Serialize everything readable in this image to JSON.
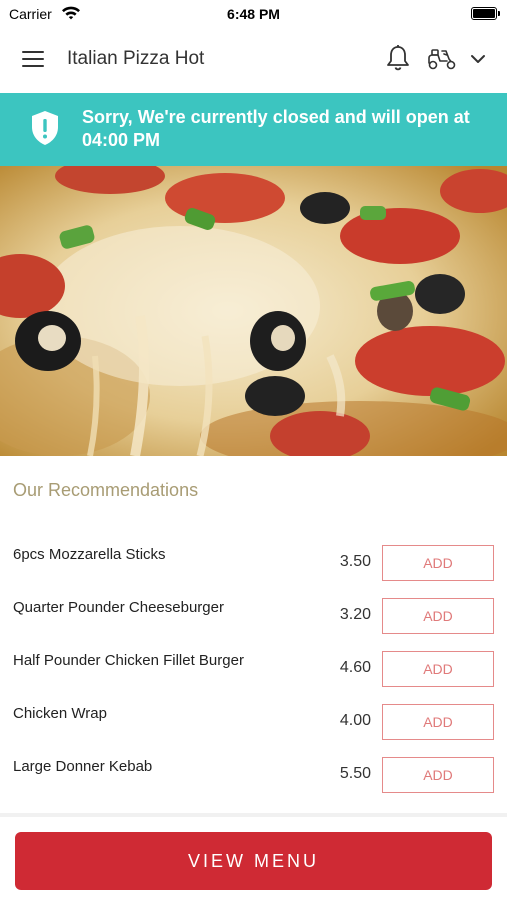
{
  "status_bar": {
    "carrier": "Carrier",
    "time": "6:48 PM"
  },
  "header": {
    "title": "Italian Pizza Hot"
  },
  "banner": {
    "message": "Sorry, We're currently closed and will open at 04:00 PM",
    "color": "#3cc5c0"
  },
  "recommendations": {
    "title": "Our Recommendations",
    "items": [
      {
        "name": "6pcs Mozzarella Sticks",
        "price": "3.50",
        "button": "ADD"
      },
      {
        "name": "Quarter Pounder Cheeseburger",
        "price": "3.20",
        "button": "ADD"
      },
      {
        "name": "Half Pounder Chicken Fillet Burger",
        "price": "4.60",
        "button": "ADD"
      },
      {
        "name": "Chicken Wrap",
        "price": "4.00",
        "button": "ADD"
      },
      {
        "name": "Large Donner Kebab",
        "price": "5.50",
        "button": "ADD"
      }
    ]
  },
  "footer": {
    "view_menu_label": "VIEW MENU",
    "accent_color": "#cf2a34"
  }
}
